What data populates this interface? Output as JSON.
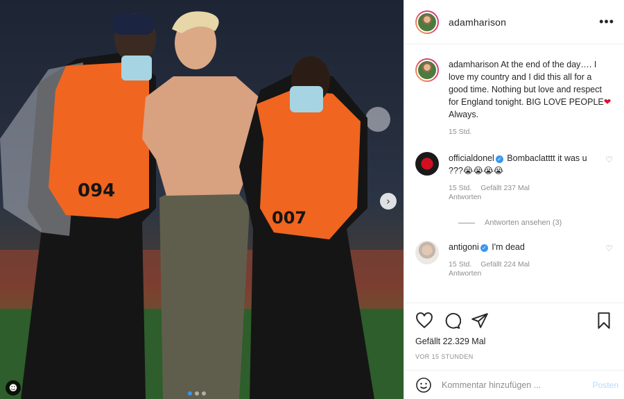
{
  "post": {
    "author": "adamharison",
    "more_icon": "more-horizontal-icon",
    "next_icon": "chevron-right-icon",
    "tag_icon": "user-tag-icon",
    "photo_vest_text_left": "094",
    "photo_vest_text_right": "007"
  },
  "caption": {
    "username": "adamharison",
    "text": "At the end of the day…. I love my country and I did this all for a good time. Nothing but love and respect for England tonight. BIG LOVE PEOPLE",
    "emoji": "❤",
    "text_after": " Always.",
    "time": "15 Std."
  },
  "comments": [
    {
      "username": "officialdonel",
      "verified": true,
      "text": "Bombaclatttt it was u ???😭😭😭😭",
      "time": "15 Std.",
      "likes": "Gefällt 237 Mal",
      "reply_label": "Antworten",
      "view_replies": "Antworten ansehen (3)"
    },
    {
      "username": "antigoni",
      "verified": true,
      "text": "I'm dead",
      "time": "15 Std.",
      "likes": "Gefällt 224 Mal",
      "reply_label": "Antworten"
    }
  ],
  "actions": {
    "like_icon": "heart-icon",
    "comment_icon": "comment-icon",
    "share_icon": "share-icon",
    "save_icon": "bookmark-icon",
    "likes_text": "Gefällt 22.329 Mal",
    "date_text": "VOR 15 STUNDEN"
  },
  "add_comment": {
    "placeholder": "Kommentar hinzufügen ...",
    "post_label": "Posten",
    "emoji_icon": "smiley-icon"
  },
  "colors": {
    "accent_blue": "#3897f0",
    "post_disabled": "#b3dbff",
    "muted": "#8e8e8e",
    "vest_orange": "#f0651f"
  }
}
